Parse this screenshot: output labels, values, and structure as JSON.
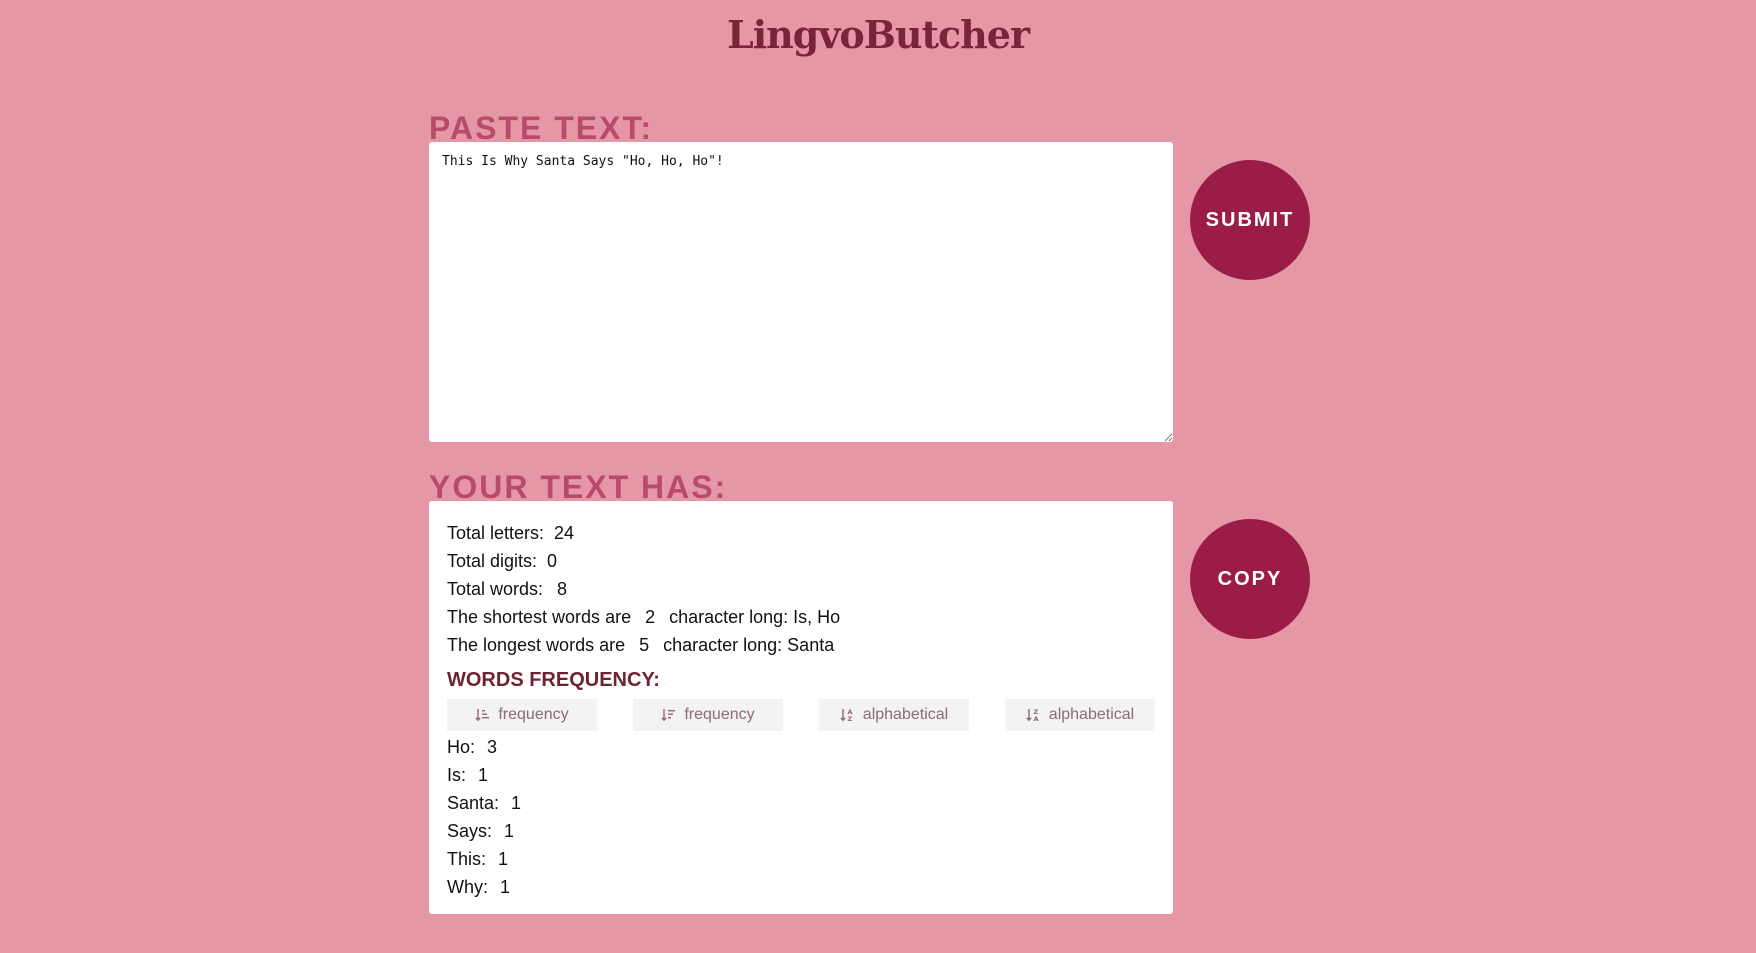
{
  "app": {
    "title": "LingvoButcher"
  },
  "input_section": {
    "heading": "PASTE TEXT:",
    "text_value": "This Is Why Santa Says \"Ho, Ho, Ho\"!",
    "submit_label": "SUBMIT"
  },
  "result_section": {
    "heading": "YOUR TEXT HAS:",
    "copy_label": "COPY",
    "stats": {
      "total_letters_label": "Total letters:",
      "total_letters_value": "24",
      "total_digits_label": "Total digits:",
      "total_digits_value": "0",
      "total_words_label": "Total words:",
      "total_words_value": "8",
      "shortest_prefix": "The shortest words are",
      "shortest_length": "2",
      "shortest_suffix": "character long: Is, Ho",
      "longest_prefix": "The longest words are",
      "longest_length": "5",
      "longest_suffix": "character long: Santa"
    },
    "frequency": {
      "heading": "WORDS FREQUENCY:",
      "sort_buttons": [
        {
          "label": "frequency",
          "icon": "sort-ascending-lines-icon"
        },
        {
          "label": "frequency",
          "icon": "sort-descending-lines-icon"
        },
        {
          "label": "alphabetical",
          "icon": "sort-alpha-asc-icon"
        },
        {
          "label": "alphabetical",
          "icon": "sort-alpha-desc-icon"
        }
      ],
      "words": [
        {
          "word": "Ho:",
          "count": "3"
        },
        {
          "word": "Is:",
          "count": "1"
        },
        {
          "word": "Santa:",
          "count": "1"
        },
        {
          "word": "Says:",
          "count": "1"
        },
        {
          "word": "This:",
          "count": "1"
        },
        {
          "word": "Why:",
          "count": "1"
        }
      ]
    }
  },
  "colors": {
    "background": "#e597a6",
    "accent": "#9b1c47",
    "heading": "#b84a6c",
    "title": "#7a2437"
  }
}
